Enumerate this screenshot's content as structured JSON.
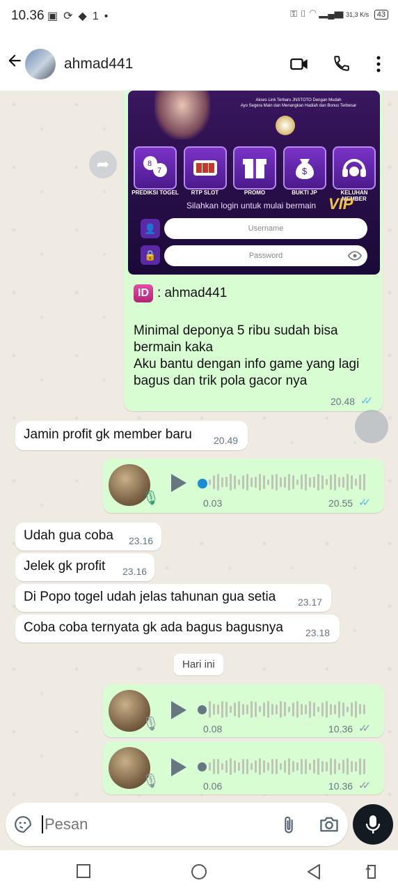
{
  "status_bar": {
    "time": "10.36",
    "icons": [
      "sim-icon",
      "sync-icon",
      "gamepad-icon",
      "one-icon",
      "dot-icon"
    ],
    "right_text": "31,3 K/s",
    "battery": "43"
  },
  "header": {
    "contact_name": "ahmad441",
    "icons": [
      "back-arrow-icon",
      "video-call-icon",
      "phone-icon",
      "more-vert-icon"
    ]
  },
  "promo_image": {
    "tagline": "Akses Link Terbaru JNSTOTO Dengan Mudah",
    "tagline2": "Ayo Segera Main dan Menangkan Hadiah dan Bonus Terbesar",
    "tiles": [
      {
        "label": "PREDIKSI TOGEL",
        "icon": "lottery-icon"
      },
      {
        "label": "RTP SLOT",
        "icon": "slot-icon"
      },
      {
        "label": "PROMO",
        "icon": "gift-icon"
      },
      {
        "label": "BUKTI JP",
        "icon": "money-bag-icon"
      },
      {
        "label": "KELUHAN MEMBER",
        "icon": "headset-icon"
      }
    ],
    "login_prompt": "Silahkan login untuk mulai bermain",
    "vip": "VIP",
    "username_placeholder": "Username",
    "password_placeholder": "Password"
  },
  "messages": {
    "promo_caption": {
      "id_badge": "ID",
      "id_line": ": ahmad441",
      "line1": "Minimal deponya 5 ribu sudah bisa",
      "line2": "bermain kaka",
      "line3": "Aku bantu dengan info game yang lagi",
      "line4": "bagus dan trik pola gacor nya",
      "time": "20.48"
    },
    "in1": {
      "text": "Jamin profit gk member baru",
      "time": "20.49"
    },
    "voice1": {
      "duration": "0.03",
      "time": "20.55"
    },
    "in2": {
      "text": "Udah gua coba",
      "time": "23.16"
    },
    "in3": {
      "text": "Jelek gk profit",
      "time": "23.16"
    },
    "in4": {
      "text": "Di Popo togel udah jelas tahunan gua setia",
      "time": "23.17"
    },
    "in5": {
      "text": "Coba coba ternyata gk ada bagus bagusnya",
      "time": "23.18"
    },
    "day_divider": "Hari ini",
    "voice2": {
      "duration": "0.08",
      "time": "10.36"
    },
    "voice3": {
      "duration": "0.06",
      "time": "10.36"
    }
  },
  "composer": {
    "placeholder": "Pesan",
    "icons": [
      "sticker-icon",
      "attach-icon",
      "camera-icon",
      "mic-icon"
    ]
  },
  "nav_bar": {
    "icons": [
      "recent-apps-icon",
      "home-icon",
      "back-icon",
      "rotate-icon"
    ]
  },
  "colors": {
    "outgoing_bubble": "#d9fdd3",
    "incoming_bubble": "#ffffff",
    "read_ticks": "#53bdeb",
    "chat_bg": "#efeae2"
  }
}
